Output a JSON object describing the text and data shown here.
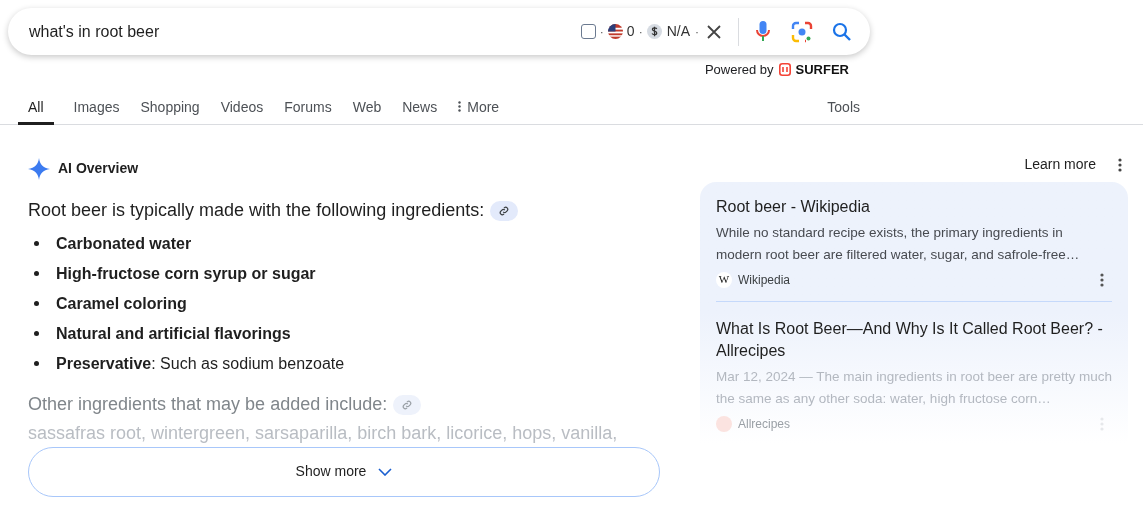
{
  "search": {
    "value": "what's in root beer",
    "checked": false,
    "country_count": "0",
    "price": "N/A",
    "separator": "·"
  },
  "powered_by": {
    "label": "Powered by",
    "brand": "SURFER"
  },
  "tabs": [
    {
      "label": "All",
      "selected": true
    },
    {
      "label": "Images",
      "selected": false
    },
    {
      "label": "Shopping",
      "selected": false
    },
    {
      "label": "Videos",
      "selected": false
    },
    {
      "label": "Forums",
      "selected": false
    },
    {
      "label": "Web",
      "selected": false
    },
    {
      "label": "News",
      "selected": false
    },
    {
      "label": "More",
      "kind": "menu",
      "selected": false
    }
  ],
  "tools": "Tools",
  "ai_overview": {
    "title": "AI Overview",
    "learn_more": "Learn more",
    "intro": "Root beer is typically made with the following ingredients:",
    "items": [
      "**Carbonated water**",
      "**High-fructose corn syrup or sugar**",
      "**Caramel coloring**",
      "**Natural and artificial flavorings**",
      "**Preservative**: Such as sodium benzoate"
    ],
    "other": "Other ingredients that may be added include:",
    "faded_line": "sassafras root, wintergreen, sarsaparilla, birch bark, licorice, hops, vanilla,",
    "show_more": "Show more"
  },
  "sources": [
    {
      "title": "Root beer - Wikipedia",
      "snippet": "While no standard recipe exists, the primary ingredients in modern root beer are filtered water, sugar, and safrole-free…",
      "site": "Wikipedia",
      "logo": "W",
      "faded": false
    },
    {
      "title": "What Is Root Beer—And Why Is It Called Root Beer? - Allrecipes",
      "snippet": "Mar 12, 2024 — The main ingredients in root beer are pretty much the same as any other soda: water, high fructose corn…",
      "site": "Allrecipes",
      "faded": true
    }
  ]
}
